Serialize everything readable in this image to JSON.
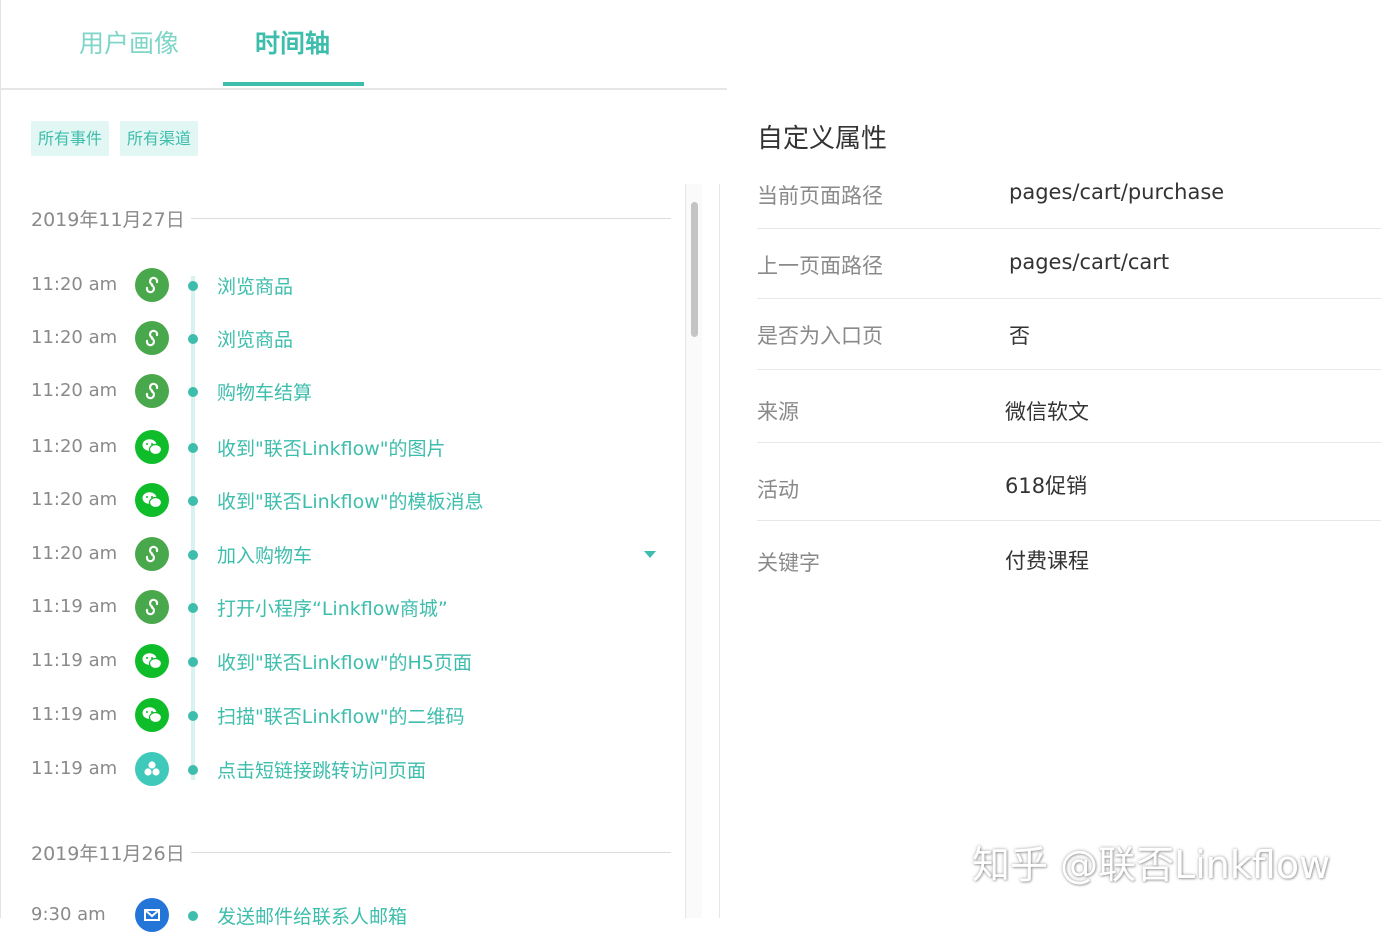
{
  "tabs": [
    {
      "label": "用户画像",
      "active": false
    },
    {
      "label": "时间轴",
      "active": true
    }
  ],
  "filters": {
    "events": "所有事件",
    "channels": "所有渠道"
  },
  "timeline": {
    "groups": [
      {
        "date": "2019年11月27日",
        "events": [
          {
            "time": "11:20 am",
            "icon": "mini-program-icon",
            "label": "浏览商品"
          },
          {
            "time": "11:20 am",
            "icon": "mini-program-icon",
            "label": "浏览商品"
          },
          {
            "time": "11:20 am",
            "icon": "mini-program-icon",
            "label": "购物车结算"
          },
          {
            "time": "11:20 am",
            "icon": "wechat-icon",
            "label": "收到\"联否Linkflow\"的图片"
          },
          {
            "time": "11:20 am",
            "icon": "wechat-icon",
            "label": "收到\"联否Linkflow\"的模板消息"
          },
          {
            "time": "11:20 am",
            "icon": "mini-program-icon",
            "label": "加入购物车"
          },
          {
            "time": "11:19 am",
            "icon": "mini-program-icon",
            "label": "打开小程序“Linkflow商城”"
          },
          {
            "time": "11:19 am",
            "icon": "wechat-icon",
            "label": "收到\"联否Linkflow\"的H5页面"
          },
          {
            "time": "11:19 am",
            "icon": "wechat-icon",
            "label": "扫描\"联否Linkflow\"的二维码"
          },
          {
            "time": "11:19 am",
            "icon": "short-link-icon",
            "label": "点击短链接跳转访问页面"
          }
        ]
      },
      {
        "date": "2019年11月26日",
        "events": [
          {
            "time": "9:30 am",
            "icon": "mail-icon",
            "label": "发送邮件给联系人邮箱"
          }
        ]
      }
    ]
  },
  "attributes": {
    "title": "自定义属性",
    "rows": [
      {
        "key": "当前页面路径",
        "value": "pages/cart/purchase"
      },
      {
        "key": "上一页面路径",
        "value": "pages/cart/cart"
      },
      {
        "key": "是否为入口页",
        "value": "否"
      },
      {
        "key": "来源",
        "value": "微信软文"
      },
      {
        "key": "活动",
        "value": "618促销"
      },
      {
        "key": "关键字",
        "value": "付费课程"
      }
    ]
  },
  "watermark": "知乎 @联否Linkflow",
  "colors": {
    "accent": "#3dbdac",
    "miniprogram": "#4aa84c",
    "wechat": "#0fbd2a",
    "shortlink": "#3ec9bb",
    "mail": "#2475d8"
  }
}
